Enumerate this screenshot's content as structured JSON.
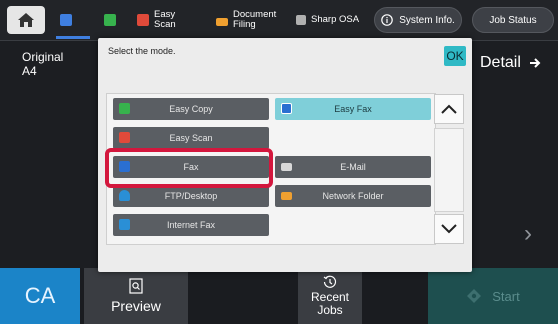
{
  "topbar": {
    "shortcuts": [
      {
        "label": "Easy\nScan",
        "icon": "easy-scan-icon",
        "color": "#e04a3a"
      },
      {
        "label": "Document\nFiling",
        "icon": "document-filing-icon",
        "color": "#f0a030"
      },
      {
        "label": "Sharp OSA",
        "icon": "sharp-osa-icon",
        "color": "#b0b0b0"
      }
    ],
    "system_info": "System Info.",
    "job_status": "Job Status"
  },
  "original": {
    "label": "Original",
    "size": "A4"
  },
  "detail_label": "Detail",
  "dialog": {
    "title": "Select the mode.",
    "ok": "OK",
    "modes": [
      {
        "label": "Easy Copy",
        "icon_color": "#37b24d"
      },
      {
        "label": "Easy Fax",
        "icon_color": "#2a6fd1",
        "selected": true
      },
      {
        "label": "Easy Scan",
        "icon_color": "#e04a3a"
      },
      {
        "label": "Fax",
        "icon_color": "#2a6fd1",
        "highlighted": true
      },
      {
        "label": "E-Mail",
        "icon_color": "#d8d8d8"
      },
      {
        "label": "FTP/Desktop",
        "icon_color": "#2a8fd6"
      },
      {
        "label": "Network Folder",
        "icon_color": "#f0a030"
      },
      {
        "label": "Internet Fax",
        "icon_color": "#2a8fd6"
      }
    ]
  },
  "bottom": {
    "ca": "CA",
    "preview": "Preview",
    "recent_jobs": "Recent\nJobs",
    "start": "Start"
  },
  "colors": {
    "accent_blue": "#1b84c8",
    "highlight_red": "#d3173d",
    "selected_teal": "#7fcfd9",
    "start_teal": "#1e4f4f"
  }
}
